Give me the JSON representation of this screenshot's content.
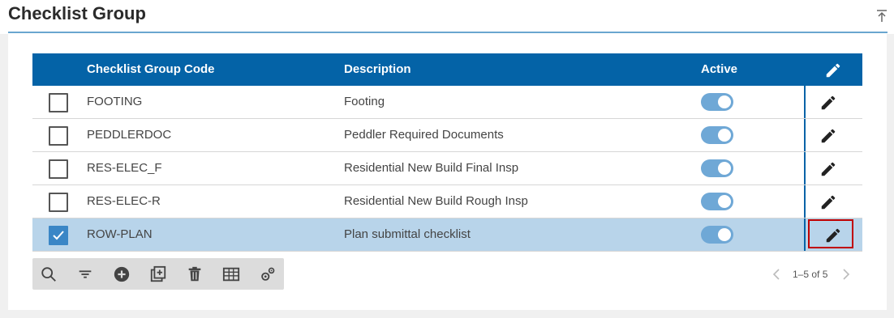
{
  "page": {
    "title": "Checklist Group"
  },
  "table": {
    "columns": {
      "code": "Checklist Group Code",
      "description": "Description",
      "active": "Active"
    },
    "rows": [
      {
        "code": "FOOTING",
        "description": "Footing",
        "checked": false,
        "active": true
      },
      {
        "code": "PEDDLERDOC",
        "description": "Peddler Required Documents",
        "checked": false,
        "active": true
      },
      {
        "code": "RES-ELEC_F",
        "description": "Residential New Build Final Insp",
        "checked": false,
        "active": true
      },
      {
        "code": "RES-ELEC-R",
        "description": "Residential New Build Rough Insp",
        "checked": false,
        "active": true
      },
      {
        "code": "ROW-PLAN",
        "description": "Plan submittal checklist",
        "checked": true,
        "active": true
      }
    ]
  },
  "toolbar": {
    "icons": [
      "search-icon",
      "filter-icon",
      "add-icon",
      "duplicate-icon",
      "delete-icon",
      "grid-icon",
      "settings-icon"
    ]
  },
  "pager": {
    "label": "1–5 of 5"
  },
  "colors": {
    "header": "#0463a7",
    "selected_row": "#b8d4ea",
    "toggle": "#6fa8d6",
    "focus": "#c00000"
  }
}
